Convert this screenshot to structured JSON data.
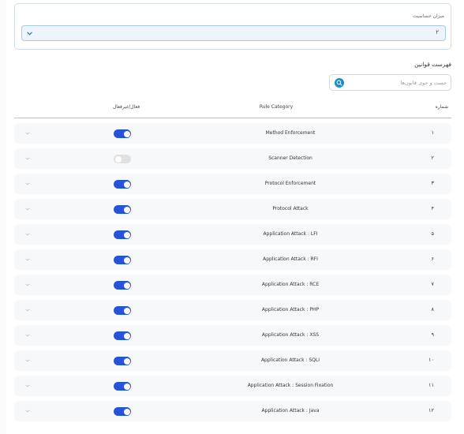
{
  "sensitivity": {
    "label": "میزان حساسیت",
    "value": "۲"
  },
  "rules": {
    "title": "فهرست قوانین",
    "search_placeholder": "جست و جوی قانون‌ها"
  },
  "table": {
    "headers": {
      "number": "شماره",
      "category": "Rule Category",
      "active": "فعال/غیرفعال"
    },
    "rows": [
      {
        "number": "۱",
        "category": "Method Enforcement",
        "enabled": true
      },
      {
        "number": "۲",
        "category": "Scanner Detection",
        "enabled": false
      },
      {
        "number": "۳",
        "category": "Protocol Enforcement",
        "enabled": true
      },
      {
        "number": "۴",
        "category": "Protocol Attack",
        "enabled": true
      },
      {
        "number": "۵",
        "category": "Application Attack : LFI",
        "enabled": true
      },
      {
        "number": "۶",
        "category": "Application Attack : RFI",
        "enabled": true
      },
      {
        "number": "۷",
        "category": "Application Attack : RCE",
        "enabled": true
      },
      {
        "number": "۸",
        "category": "Application Attack : PHP",
        "enabled": true
      },
      {
        "number": "۹",
        "category": "Application Attack : XSS",
        "enabled": true
      },
      {
        "number": "۱۰",
        "category": "Application Attack : SQLI",
        "enabled": true
      },
      {
        "number": "۱۱",
        "category": "Application Attack : Session Fixation",
        "enabled": true
      },
      {
        "number": "۱۲",
        "category": "Application Attack : Java",
        "enabled": true
      }
    ]
  },
  "colors": {
    "toggle_on": "#2554d6",
    "toggle_off": "#e0e0e0",
    "select_bg": "#eef4fb",
    "search_icon": "#1a8ec9"
  },
  "icons": {
    "select_chevron": "chevron-down-icon",
    "row_expand": "chevron-down-icon",
    "search": "search-icon"
  }
}
